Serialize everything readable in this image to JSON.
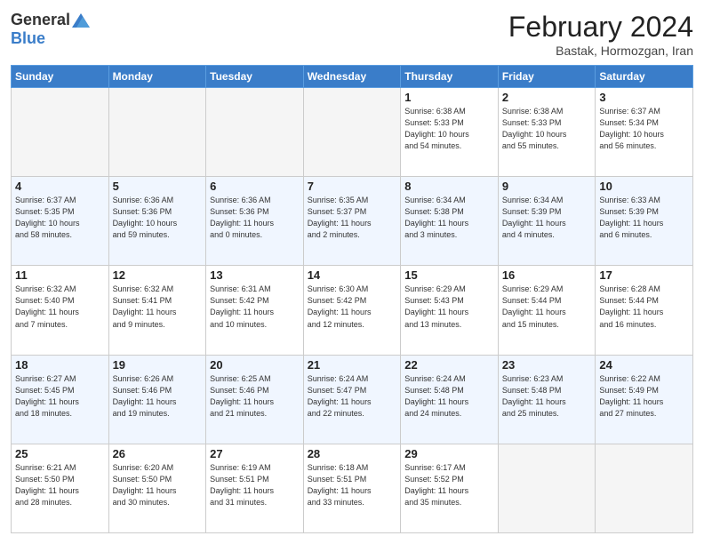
{
  "header": {
    "logo": {
      "general": "General",
      "blue": "Blue"
    },
    "title": "February 2024",
    "location": "Bastak, Hormozgan, Iran"
  },
  "weekdays": [
    "Sunday",
    "Monday",
    "Tuesday",
    "Wednesday",
    "Thursday",
    "Friday",
    "Saturday"
  ],
  "weeks": [
    [
      {
        "day": "",
        "info": ""
      },
      {
        "day": "",
        "info": ""
      },
      {
        "day": "",
        "info": ""
      },
      {
        "day": "",
        "info": ""
      },
      {
        "day": "1",
        "info": "Sunrise: 6:38 AM\nSunset: 5:33 PM\nDaylight: 10 hours\nand 54 minutes."
      },
      {
        "day": "2",
        "info": "Sunrise: 6:38 AM\nSunset: 5:33 PM\nDaylight: 10 hours\nand 55 minutes."
      },
      {
        "day": "3",
        "info": "Sunrise: 6:37 AM\nSunset: 5:34 PM\nDaylight: 10 hours\nand 56 minutes."
      }
    ],
    [
      {
        "day": "4",
        "info": "Sunrise: 6:37 AM\nSunset: 5:35 PM\nDaylight: 10 hours\nand 58 minutes."
      },
      {
        "day": "5",
        "info": "Sunrise: 6:36 AM\nSunset: 5:36 PM\nDaylight: 10 hours\nand 59 minutes."
      },
      {
        "day": "6",
        "info": "Sunrise: 6:36 AM\nSunset: 5:36 PM\nDaylight: 11 hours\nand 0 minutes."
      },
      {
        "day": "7",
        "info": "Sunrise: 6:35 AM\nSunset: 5:37 PM\nDaylight: 11 hours\nand 2 minutes."
      },
      {
        "day": "8",
        "info": "Sunrise: 6:34 AM\nSunset: 5:38 PM\nDaylight: 11 hours\nand 3 minutes."
      },
      {
        "day": "9",
        "info": "Sunrise: 6:34 AM\nSunset: 5:39 PM\nDaylight: 11 hours\nand 4 minutes."
      },
      {
        "day": "10",
        "info": "Sunrise: 6:33 AM\nSunset: 5:39 PM\nDaylight: 11 hours\nand 6 minutes."
      }
    ],
    [
      {
        "day": "11",
        "info": "Sunrise: 6:32 AM\nSunset: 5:40 PM\nDaylight: 11 hours\nand 7 minutes."
      },
      {
        "day": "12",
        "info": "Sunrise: 6:32 AM\nSunset: 5:41 PM\nDaylight: 11 hours\nand 9 minutes."
      },
      {
        "day": "13",
        "info": "Sunrise: 6:31 AM\nSunset: 5:42 PM\nDaylight: 11 hours\nand 10 minutes."
      },
      {
        "day": "14",
        "info": "Sunrise: 6:30 AM\nSunset: 5:42 PM\nDaylight: 11 hours\nand 12 minutes."
      },
      {
        "day": "15",
        "info": "Sunrise: 6:29 AM\nSunset: 5:43 PM\nDaylight: 11 hours\nand 13 minutes."
      },
      {
        "day": "16",
        "info": "Sunrise: 6:29 AM\nSunset: 5:44 PM\nDaylight: 11 hours\nand 15 minutes."
      },
      {
        "day": "17",
        "info": "Sunrise: 6:28 AM\nSunset: 5:44 PM\nDaylight: 11 hours\nand 16 minutes."
      }
    ],
    [
      {
        "day": "18",
        "info": "Sunrise: 6:27 AM\nSunset: 5:45 PM\nDaylight: 11 hours\nand 18 minutes."
      },
      {
        "day": "19",
        "info": "Sunrise: 6:26 AM\nSunset: 5:46 PM\nDaylight: 11 hours\nand 19 minutes."
      },
      {
        "day": "20",
        "info": "Sunrise: 6:25 AM\nSunset: 5:46 PM\nDaylight: 11 hours\nand 21 minutes."
      },
      {
        "day": "21",
        "info": "Sunrise: 6:24 AM\nSunset: 5:47 PM\nDaylight: 11 hours\nand 22 minutes."
      },
      {
        "day": "22",
        "info": "Sunrise: 6:24 AM\nSunset: 5:48 PM\nDaylight: 11 hours\nand 24 minutes."
      },
      {
        "day": "23",
        "info": "Sunrise: 6:23 AM\nSunset: 5:48 PM\nDaylight: 11 hours\nand 25 minutes."
      },
      {
        "day": "24",
        "info": "Sunrise: 6:22 AM\nSunset: 5:49 PM\nDaylight: 11 hours\nand 27 minutes."
      }
    ],
    [
      {
        "day": "25",
        "info": "Sunrise: 6:21 AM\nSunset: 5:50 PM\nDaylight: 11 hours\nand 28 minutes."
      },
      {
        "day": "26",
        "info": "Sunrise: 6:20 AM\nSunset: 5:50 PM\nDaylight: 11 hours\nand 30 minutes."
      },
      {
        "day": "27",
        "info": "Sunrise: 6:19 AM\nSunset: 5:51 PM\nDaylight: 11 hours\nand 31 minutes."
      },
      {
        "day": "28",
        "info": "Sunrise: 6:18 AM\nSunset: 5:51 PM\nDaylight: 11 hours\nand 33 minutes."
      },
      {
        "day": "29",
        "info": "Sunrise: 6:17 AM\nSunset: 5:52 PM\nDaylight: 11 hours\nand 35 minutes."
      },
      {
        "day": "",
        "info": ""
      },
      {
        "day": "",
        "info": ""
      }
    ]
  ]
}
